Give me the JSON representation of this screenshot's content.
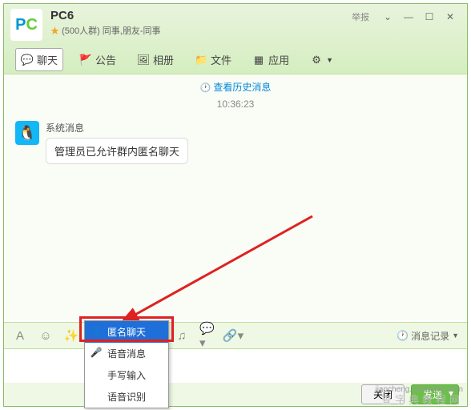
{
  "header": {
    "logo_text": "PC6",
    "title": "PC6",
    "subtitle": "(500人群) 同事,朋友-同事",
    "report": "举报"
  },
  "tabs": {
    "chat": "聊天",
    "notice": "公告",
    "album": "相册",
    "files": "文件",
    "apps": "应用"
  },
  "content": {
    "history_link": "查看历史消息",
    "timestamp": "10:36:23",
    "sender": "系统消息",
    "message": "管理员已允许群内匿名聊天"
  },
  "toolbar": {
    "history_record": "消息记录"
  },
  "dropdown": {
    "items": [
      {
        "label": "匿名聊天",
        "selected": true
      },
      {
        "label": "语音消息",
        "selected": false
      },
      {
        "label": "手写输入",
        "selected": false
      },
      {
        "label": "语音识别",
        "selected": false
      }
    ]
  },
  "buttons": {
    "close": "关闭",
    "send": "发送"
  },
  "watermark": {
    "main": "查字典教程网",
    "sub": "jiaocheng.chazidian.com"
  }
}
